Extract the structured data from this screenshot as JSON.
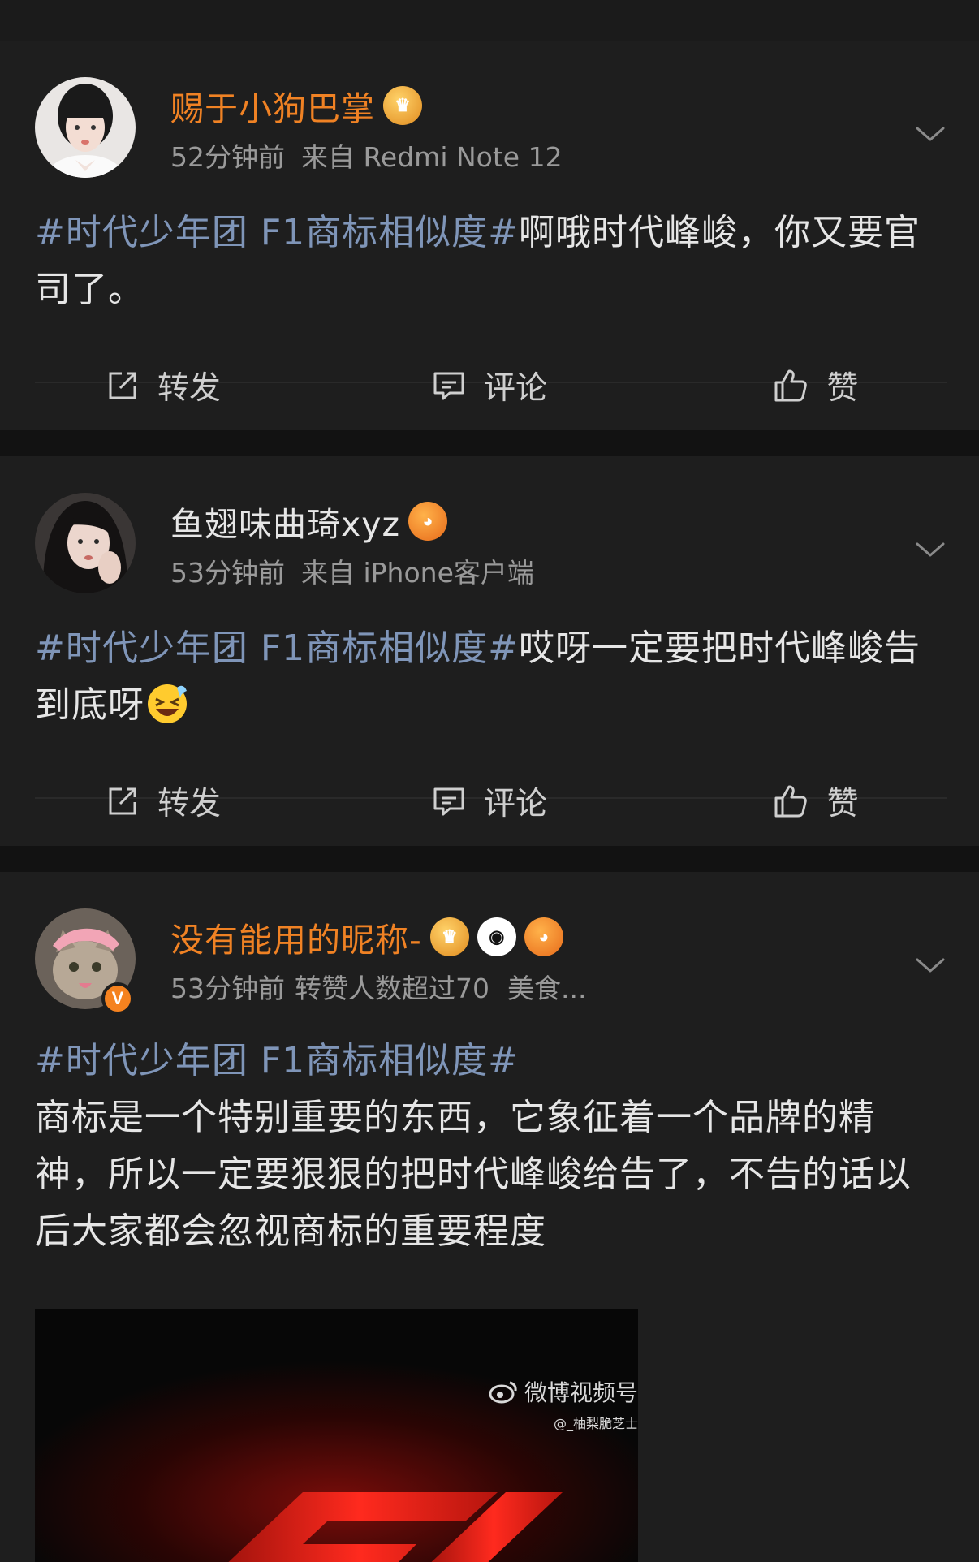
{
  "colors": {
    "background": "#121212",
    "card": "#1e1e1e",
    "vip_name": "#f08224",
    "hashtag": "#7f95b8",
    "meta": "#9a9a9a",
    "f1_red": "#e0231c"
  },
  "posts": [
    {
      "username": "赐于小狗巴掌",
      "time": "52分钟前",
      "source": "来自 Redmi Note 12",
      "hashtag": "#时代少年团 F1商标相似度#",
      "text": "啊哦时代峰峻，你又要官司了。",
      "actions": {
        "repost": "转发",
        "comment": "评论",
        "like": "赞"
      }
    },
    {
      "username": "鱼翅味曲琦xyz",
      "time": "53分钟前",
      "source": "来自 iPhone客户端",
      "hashtag": "#时代少年团 F1商标相似度#",
      "text": "哎呀一定要把时代峰峻告到底呀",
      "actions": {
        "repost": "转发",
        "comment": "评论",
        "like": "赞"
      }
    },
    {
      "username": "没有能用的昵称-",
      "time": "53分钟前",
      "source": "转赞人数超过70",
      "extra": "美食...",
      "verified": "V",
      "hashtag": "#时代少年团 F1商标相似度#",
      "text": "商标是一个特别重要的东西，它象征着一个品牌的精神，所以一定要狠狠的把时代峰峻给告了，不告的话以后大家都会忽视商标的重要程度",
      "media": {
        "watermark": "微博视频号",
        "watermark_sub": "@_柚梨脆芝士"
      }
    }
  ],
  "icons": [
    "repost-icon",
    "comment-icon",
    "like-icon",
    "chevron-down-icon",
    "crown-badge-icon",
    "fish-badge-icon",
    "panda-badge-icon",
    "weibo-logo-icon"
  ]
}
